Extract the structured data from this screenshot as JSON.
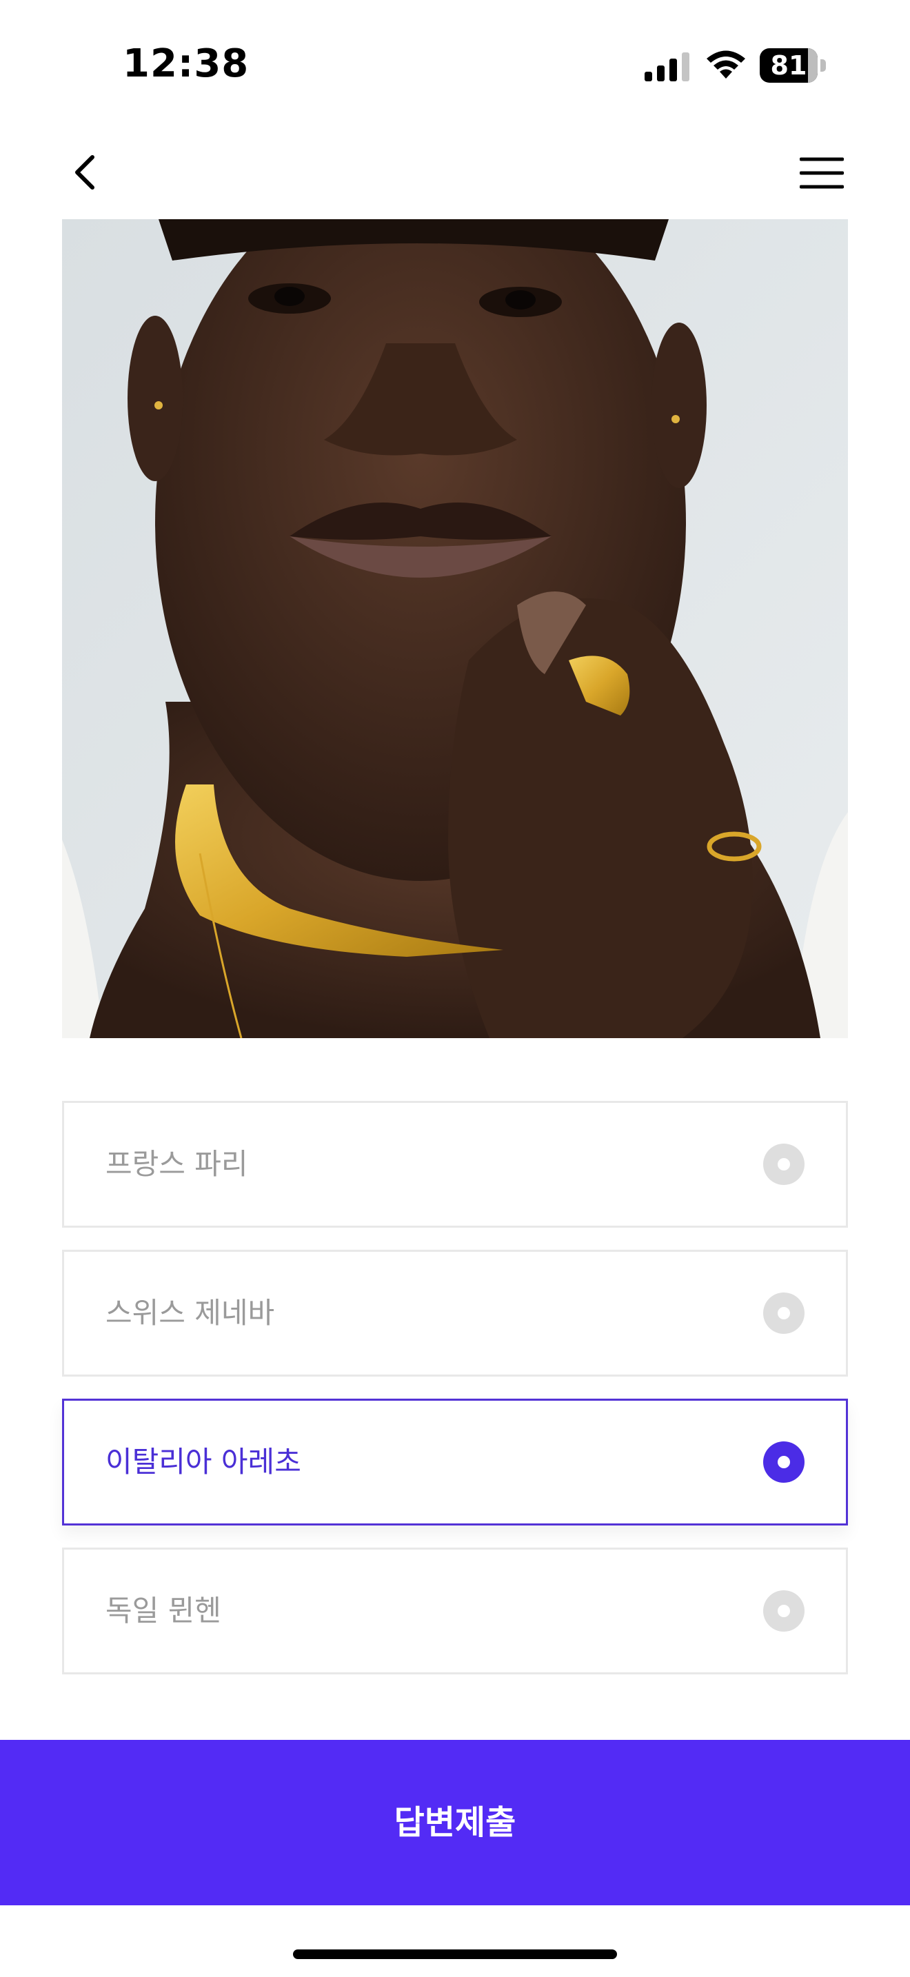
{
  "status_bar": {
    "time": "12:38",
    "battery_level": "81",
    "icons": [
      "signal-icon",
      "wifi-icon",
      "battery-icon"
    ]
  },
  "nav": {
    "back_icon": "chevron-left-icon",
    "menu_icon": "hamburger-menu-icon"
  },
  "hero": {
    "image": "portrait-with-gold-jewelry"
  },
  "options": [
    {
      "label": "프랑스 파리",
      "selected": false
    },
    {
      "label": "스위스 제네바",
      "selected": false
    },
    {
      "label": "이탈리아 아레초",
      "selected": true
    },
    {
      "label": "독일 뮌헨",
      "selected": false
    }
  ],
  "submit": {
    "label": "답변제출"
  },
  "colors": {
    "accent": "#532BF5",
    "selected_text": "#4A2FD6",
    "unselected_text": "#9A9A9A",
    "radio_off": "#DEDEDE",
    "border": "#E8E8E8"
  }
}
